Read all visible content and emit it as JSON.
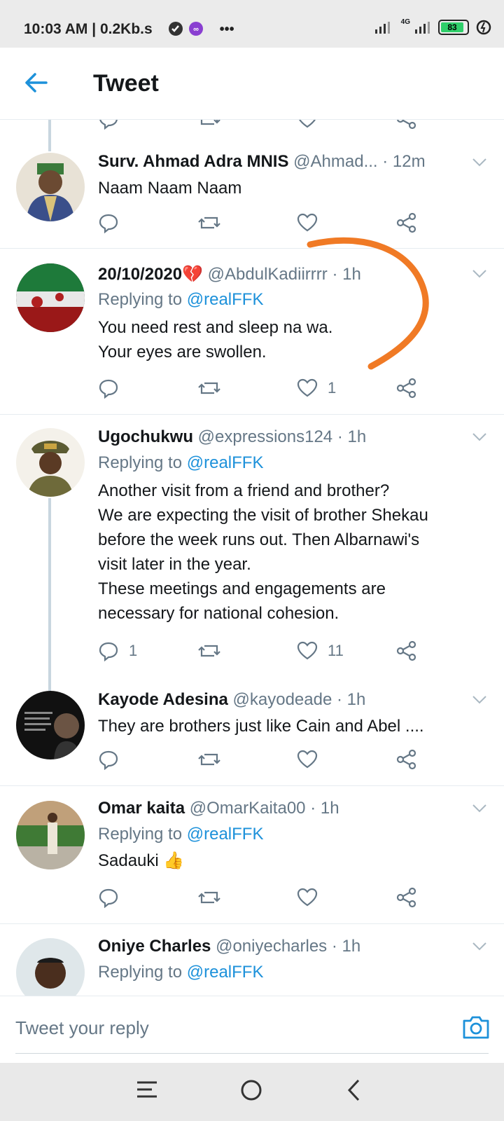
{
  "status_bar": {
    "time": "10:03 AM | 0.2Kb.s",
    "extra": "•••",
    "network": "4G",
    "battery": "83"
  },
  "header": {
    "title": "Tweet"
  },
  "tweets": [
    {
      "name": "Surv. Ahmad Adra MNIS",
      "handle": "@Ahmad...",
      "time": "· 12m",
      "text": "Naam Naam Naam",
      "replies": "",
      "likes": ""
    },
    {
      "name": "20/10/2020💔",
      "handle": "@AbdulKadiirrrr",
      "time": "· 1h",
      "replying_label": "Replying to",
      "replying_handle": "@realFFK",
      "text_lines": [
        "You need rest and sleep na wa.",
        "Your eyes are swollen."
      ],
      "replies": "",
      "likes": "1"
    },
    {
      "name": "Ugochukwu",
      "handle": "@expressions124",
      "time": "· 1h",
      "replying_label": "Replying to",
      "replying_handle": "@realFFK",
      "text_lines": [
        "Another visit from a friend and brother?",
        "We are expecting the visit of brother Shekau",
        "before the week runs out. Then Albarnawi's",
        "visit later in the year.",
        "These meetings and engagements are",
        "necessary for national cohesion."
      ],
      "replies": "1",
      "likes": "11"
    },
    {
      "name": "Kayode Adesina",
      "handle": "@kayodeade",
      "time": "· 1h",
      "text": "They are brothers just like Cain and Abel ....",
      "replies": "",
      "likes": ""
    },
    {
      "name": "Omar kaita",
      "handle": "@OmarKaita00",
      "time": "· 1h",
      "replying_label": "Replying to",
      "replying_handle": "@realFFK",
      "text": "Sadauki 👍",
      "replies": "",
      "likes": ""
    },
    {
      "name": "Oniye Charles",
      "handle": "@oniyecharles",
      "time": "· 1h",
      "replying_label": "Replying to",
      "replying_handle": "@realFFK"
    }
  ],
  "reply_bar": {
    "placeholder": "Tweet your reply"
  },
  "colors": {
    "accent": "#1d91da",
    "annotation": "#f07a25",
    "muted": "#657786"
  }
}
